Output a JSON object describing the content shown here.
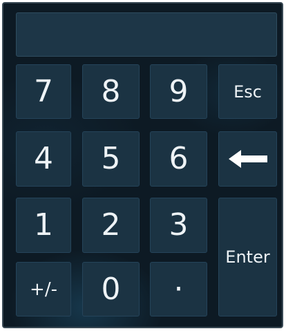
{
  "display": {
    "value": ""
  },
  "keys": {
    "k7": "7",
    "k8": "8",
    "k9": "9",
    "esc": "Esc",
    "k4": "4",
    "k5": "5",
    "k6": "6",
    "backspace_icon": "left-arrow",
    "k1": "1",
    "k2": "2",
    "k3": "3",
    "enter": "Enter",
    "sign": "+/-",
    "k0": "0",
    "decimal": "·"
  },
  "colors": {
    "background": "#0d1a24",
    "key": "#1b3343",
    "display": "#1d3647",
    "text": "#eef3f6"
  }
}
